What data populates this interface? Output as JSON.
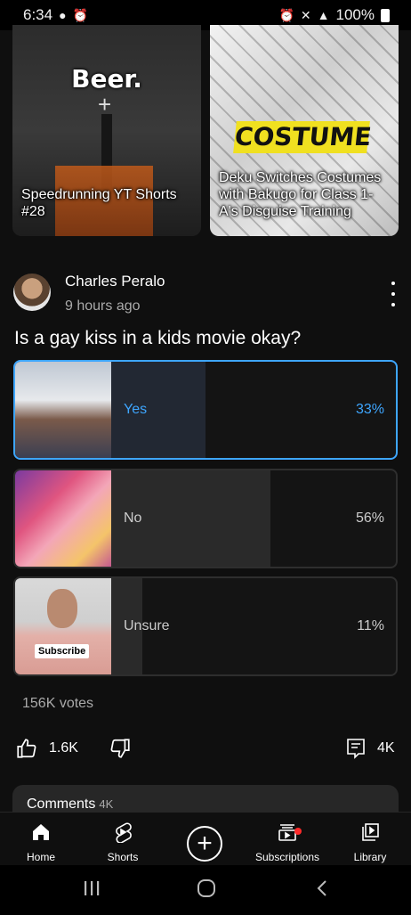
{
  "status": {
    "time": "6:34",
    "battery": "100%"
  },
  "shorts": [
    {
      "title": "Speedrunning YT Shorts #28",
      "overlay_text": "Beer."
    },
    {
      "title": "Deku Switches Costumes with Bakugo for Class 1-A's Disguise Training",
      "overlay_text": "COSTUME"
    }
  ],
  "post": {
    "author": "Charles Peralo",
    "time": "9 hours ago",
    "question": "Is a gay kiss in a kids movie okay?",
    "options": [
      {
        "label": "Yes",
        "percent": "33%",
        "fraction": 0.33,
        "selected": true
      },
      {
        "label": "No",
        "percent": "56%",
        "fraction": 0.56,
        "selected": false
      },
      {
        "label": "Unsure",
        "percent": "11%",
        "fraction": 0.11,
        "selected": false,
        "thumb_badge": "Subscribe"
      }
    ],
    "votes": "156K votes",
    "likes": "1.6K",
    "comments_count": "4K"
  },
  "comments": {
    "label": "Comments",
    "count": "4K"
  },
  "nav": {
    "home": "Home",
    "shorts": "Shorts",
    "subscriptions": "Subscriptions",
    "library": "Library"
  },
  "colors": {
    "accent": "#3ea6ff",
    "background": "#0f0f0f",
    "notification": "#ff2a2a"
  }
}
